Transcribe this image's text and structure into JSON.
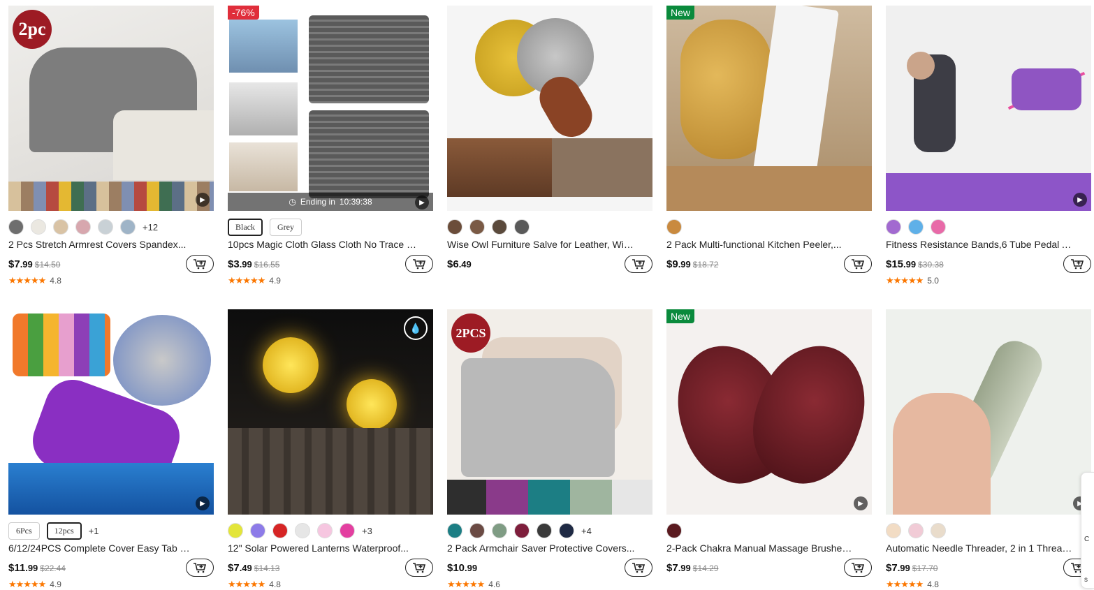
{
  "products": [
    {
      "title": "2 Pcs Stretch Armrest Covers Spandex...",
      "price_symbol": "$",
      "price_int": "7",
      "price_dec": ".99",
      "orig_price": "$14.50",
      "rating": "4.8",
      "badge_text": "",
      "pcs_text": "2pc",
      "extra_count": "+12",
      "ending": "",
      "chips": [],
      "swatch_colors": [
        "#6e6e6e",
        "#ebe8e1",
        "#d9c3a5",
        "#d7a7ae",
        "#c9d1d6",
        "#9fb4c7"
      ]
    },
    {
      "title": "10pcs Magic Cloth Glass Cloth No Trace No...",
      "price_symbol": "$",
      "price_int": "3",
      "price_dec": ".99",
      "orig_price": "$16.55",
      "rating": "4.9",
      "badge_text": "-76%",
      "pcs_text": "",
      "extra_count": "",
      "ending_label": "Ending in",
      "ending_time": "10:39:38",
      "chips": [
        {
          "label": "Black",
          "selected": true
        },
        {
          "label": "Grey",
          "selected": false
        }
      ],
      "swatch_colors": []
    },
    {
      "title": "Wise Owl Furniture Salve for Leather, Wise...",
      "price_symbol": "$",
      "price_int": "6",
      "price_dec": ".49",
      "orig_price": "",
      "rating": "",
      "badge_text": "",
      "pcs_text": "",
      "extra_count": "",
      "chips": [],
      "swatch_colors": [
        "#6b4d3a",
        "#7a5a45",
        "#5b4a3c",
        "#5a5a5a"
      ]
    },
    {
      "title": "2 Pack Multi-functional Kitchen Peeler,...",
      "price_symbol": "$",
      "price_int": "9",
      "price_dec": ".99",
      "orig_price": "$18.72",
      "rating": "",
      "badge_text": "New",
      "pcs_text": "",
      "extra_count": "",
      "chips": [],
      "swatch_colors": [
        "#c98a3f"
      ]
    },
    {
      "title": "Fitness Resistance Bands,6 Tube Pedal Ankl...",
      "price_symbol": "$",
      "price_int": "15",
      "price_dec": ".99",
      "orig_price": "$30.38",
      "rating": "5.0",
      "badge_text": "",
      "pcs_text": "",
      "extra_count": "",
      "chips": [],
      "swatch_colors": [
        "#a26ad0",
        "#5fb0e8",
        "#e86aa8"
      ]
    },
    {
      "title": "6/12/24PCS Complete Cover Easy Tab Ope...",
      "price_symbol": "$",
      "price_int": "11",
      "price_dec": ".99",
      "orig_price": "$22.44",
      "rating": "4.9",
      "badge_text": "",
      "pcs_text": "",
      "extra_count": "+1",
      "chips": [
        {
          "label": "6Pcs",
          "selected": false
        },
        {
          "label": "12pcs",
          "selected": true
        }
      ],
      "swatch_colors": []
    },
    {
      "title": "12\" Solar Powered Lanterns Waterproof...",
      "price_symbol": "$",
      "price_int": "7",
      "price_dec": ".49",
      "orig_price": "$14.13",
      "rating": "4.8",
      "badge_text": "",
      "pcs_text": "",
      "extra_count": "+3",
      "chips": [],
      "swatch_colors": [
        "#e3e53a",
        "#8d7be8",
        "#d62525",
        "#e6e6e6",
        "#f6c6e0",
        "#e33fa0"
      ]
    },
    {
      "title": "2 Pack Armchair Saver Protective Covers...",
      "price_symbol": "$",
      "price_int": "10",
      "price_dec": ".99",
      "orig_price": "",
      "rating": "4.6",
      "badge_text": "",
      "pcs_text": "2PCS",
      "extra_count": "+4",
      "chips": [],
      "swatch_colors": [
        "#1c7e84",
        "#6b4b44",
        "#7f9c84",
        "#7e1e3c",
        "#3a3a3a",
        "#1f2a44"
      ]
    },
    {
      "title": "2-Pack Chakra Manual Massage Brushes –...",
      "price_symbol": "$",
      "price_int": "7",
      "price_dec": ".99",
      "orig_price": "$14.29",
      "rating": "",
      "badge_text": "New",
      "pcs_text": "",
      "extra_count": "",
      "chips": [],
      "swatch_colors": [
        "#5a1a1f"
      ]
    },
    {
      "title": "Automatic Needle Threader, 2 in 1 Threading...",
      "price_symbol": "$",
      "price_int": "7",
      "price_dec": ".99",
      "orig_price": "$17.70",
      "rating": "4.8",
      "badge_text": "",
      "pcs_text": "",
      "extra_count": "",
      "chips": [],
      "swatch_colors": [
        "#f2dcc4",
        "#f1cbd6",
        "#e9dccb"
      ]
    }
  ],
  "side_widget": {
    "letter_top": "C",
    "letter_bottom": "s"
  }
}
